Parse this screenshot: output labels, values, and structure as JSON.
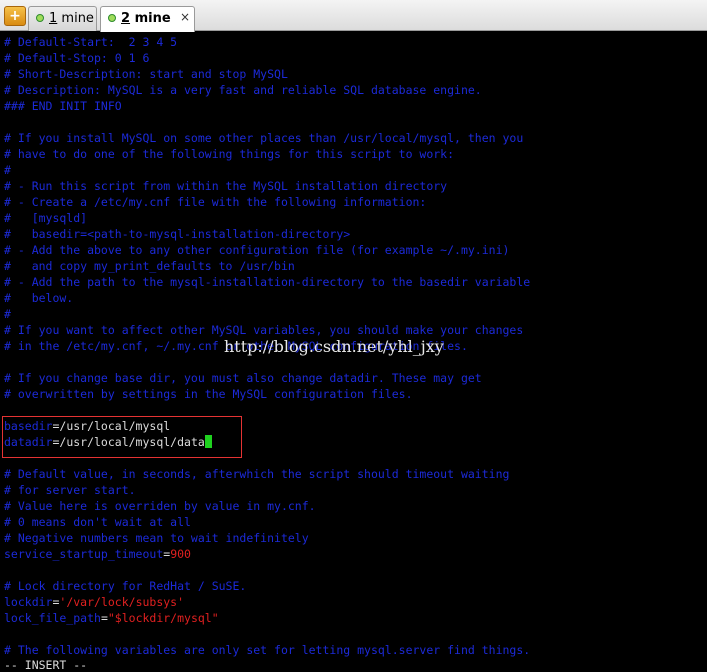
{
  "tabs": [
    {
      "number": "1",
      "name": "mine",
      "active": false
    },
    {
      "number": "2",
      "name": "mine",
      "active": true
    }
  ],
  "tab_close": "×",
  "new_tab_icon": "+",
  "lines": [
    [
      {
        "t": "# Default-Start:  2 3 4 5",
        "k": "c"
      }
    ],
    [
      {
        "t": "# Default-Stop: 0 1 6",
        "k": "c"
      }
    ],
    [
      {
        "t": "# Short-Description: start and stop MySQL",
        "k": "c"
      }
    ],
    [
      {
        "t": "# Description: MySQL is a very fast and reliable SQL database engine.",
        "k": "c"
      }
    ],
    [
      {
        "t": "### END INIT INFO",
        "k": "c"
      }
    ],
    [],
    [
      {
        "t": "# If you install MySQL on some other places than /usr/local/mysql, then you",
        "k": "c"
      }
    ],
    [
      {
        "t": "# have to do one of the following things for this script to work:",
        "k": "c"
      }
    ],
    [
      {
        "t": "#",
        "k": "c"
      }
    ],
    [
      {
        "t": "# - Run this script from within the MySQL installation directory",
        "k": "c"
      }
    ],
    [
      {
        "t": "# - Create a /etc/my.cnf file with the following information:",
        "k": "c"
      }
    ],
    [
      {
        "t": "#   [mysqld]",
        "k": "c"
      }
    ],
    [
      {
        "t": "#   basedir=<path-to-mysql-installation-directory>",
        "k": "c"
      }
    ],
    [
      {
        "t": "# - Add the above to any other configuration file (for example ~/.my.ini)",
        "k": "c"
      }
    ],
    [
      {
        "t": "#   and copy my_print_defaults to /usr/bin",
        "k": "c"
      }
    ],
    [
      {
        "t": "# - Add the path to the mysql-installation-directory to the basedir variable",
        "k": "c"
      }
    ],
    [
      {
        "t": "#   below.",
        "k": "c"
      }
    ],
    [
      {
        "t": "#",
        "k": "c"
      }
    ],
    [
      {
        "t": "# If you want to affect other MySQL variables, you should make your changes",
        "k": "c"
      }
    ],
    [
      {
        "t": "# in the /etc/my.cnf, ~/.my.cnf or other MySQL configuration files.",
        "k": "c"
      }
    ],
    [],
    [
      {
        "t": "# If you change base dir, you must also change datadir. These may get",
        "k": "c"
      }
    ],
    [
      {
        "t": "# overwritten by settings in the MySQL configuration files.",
        "k": "c"
      }
    ],
    [],
    [
      {
        "t": "basedir",
        "k": "c"
      },
      {
        "t": "=/usr/local/mysql",
        "k": "w"
      }
    ],
    [
      {
        "t": "datadir",
        "k": "c"
      },
      {
        "t": "=/usr/local/mysql/data",
        "k": "w"
      },
      {
        "cursor": true
      }
    ],
    [],
    [
      {
        "t": "# Default value, in seconds, afterwhich the script should timeout waiting",
        "k": "c"
      }
    ],
    [
      {
        "t": "# for server start.",
        "k": "c"
      }
    ],
    [
      {
        "t": "# Value here is overriden by value in my.cnf.",
        "k": "c"
      }
    ],
    [
      {
        "t": "# 0 means don't wait at all",
        "k": "c"
      }
    ],
    [
      {
        "t": "# Negative numbers mean to wait indefinitely",
        "k": "c"
      }
    ],
    [
      {
        "t": "service_startup_timeout",
        "k": "c"
      },
      {
        "t": "=",
        "k": "w"
      },
      {
        "t": "900",
        "k": "r"
      }
    ],
    [],
    [
      {
        "t": "# Lock directory for RedHat / SuSE.",
        "k": "c"
      }
    ],
    [
      {
        "t": "lockdir",
        "k": "c"
      },
      {
        "t": "=",
        "k": "w"
      },
      {
        "t": "'/var/lock/subsys'",
        "k": "r"
      }
    ],
    [
      {
        "t": "lock_file_path",
        "k": "c"
      },
      {
        "t": "=",
        "k": "w"
      },
      {
        "t": "\"$lockdir/mysql\"",
        "k": "r"
      }
    ],
    [],
    [
      {
        "t": "# The following variables are only set for letting mysql.server find things.",
        "k": "c"
      }
    ]
  ],
  "mode_line": "-- INSERT --",
  "watermark": "http://blog.csdn.net/yhl_jxy",
  "colors": {
    "comment": "#1c2ad8",
    "text": "#dcdcdc",
    "string": "#e02020",
    "cursor": "#1fd21f",
    "highlight_box": "#e53333"
  }
}
